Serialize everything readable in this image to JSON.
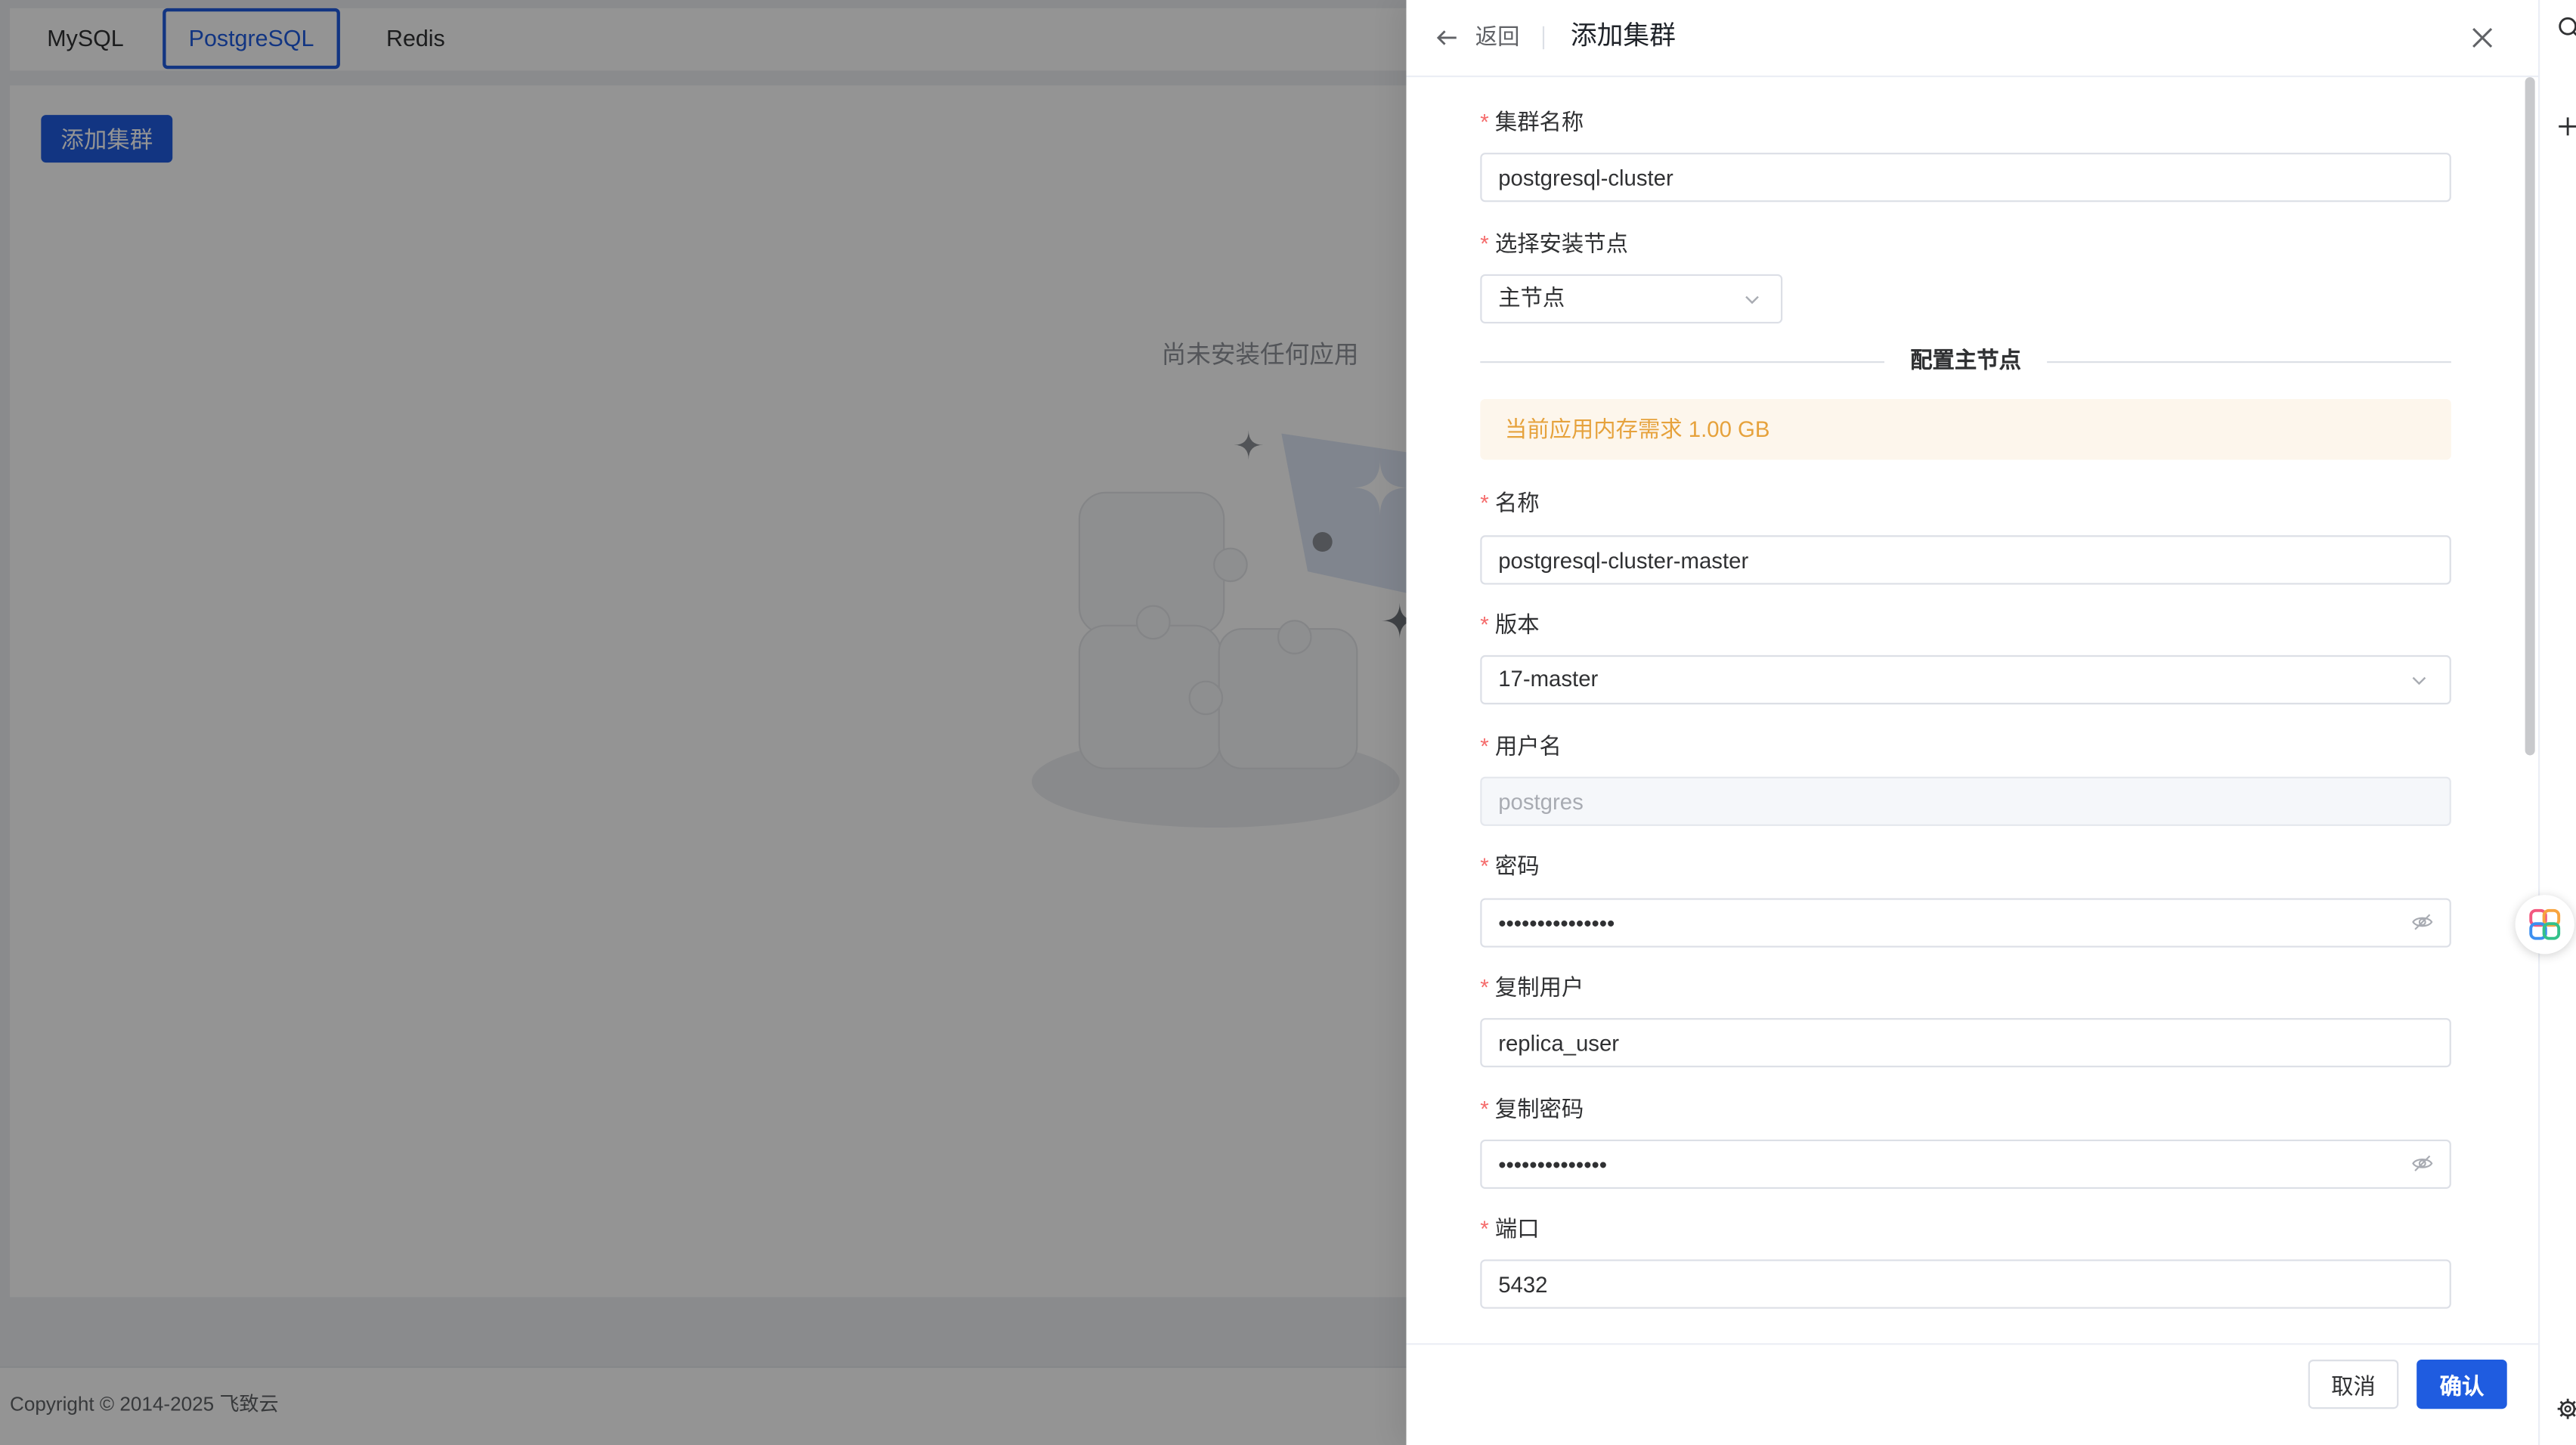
{
  "window": {
    "tabs": [
      {
        "label": "MySQL",
        "active": false
      },
      {
        "label": "PostgreSQL",
        "active": true
      },
      {
        "label": "Redis",
        "active": false
      }
    ]
  },
  "page": {
    "add_cluster_button": "添加集群",
    "empty_state_text": "尚未安装任何应用",
    "copyright": "Copyright © 2014-2025 飞致云"
  },
  "drawer": {
    "back_label": "返回",
    "title": "添加集群",
    "required_mark": "*",
    "form": {
      "cluster_name": {
        "label": "集群名称",
        "value": "postgresql-cluster"
      },
      "install_node": {
        "label": "选择安装节点",
        "value": "主节点"
      },
      "section_title": "配置主节点",
      "memory_notice": "当前应用内存需求 1.00 GB",
      "name": {
        "label": "名称",
        "value": "postgresql-cluster-master"
      },
      "version": {
        "label": "版本",
        "value": "17-master"
      },
      "username": {
        "label": "用户名",
        "value": "postgres",
        "disabled": true
      },
      "password": {
        "label": "密码",
        "value": "•••••••••••••••"
      },
      "replica_user": {
        "label": "复制用户",
        "value": "replica_user"
      },
      "replica_password": {
        "label": "复制密码",
        "value": "••••••••••••••"
      },
      "port": {
        "label": "端口",
        "value": "5432"
      }
    },
    "cancel_label": "取消",
    "confirm_label": "确认"
  },
  "icons": [
    "back-arrow-icon",
    "close-icon",
    "chevron-down-icon",
    "eye-off-icon",
    "search-icon",
    "plus-icon",
    "settings-gear-icon",
    "assistant-logo-icon",
    "empty-state-illustration"
  ],
  "colors": {
    "accent": "#1f5ce0",
    "required": "#f56c6c",
    "warning_text": "#e6a23c",
    "warning_bg": "#fdf6ec",
    "overlay": "rgba(0,0,0,0.42)"
  }
}
